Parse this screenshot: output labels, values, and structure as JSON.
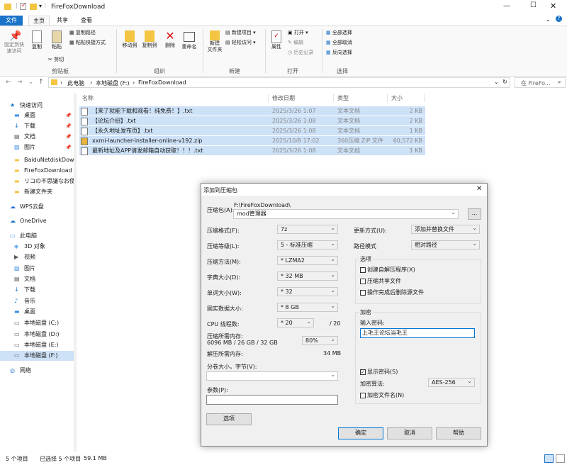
{
  "window": {
    "title": "FireFoxDownload"
  },
  "tabs": {
    "file": "文件",
    "home": "主页",
    "share": "共享",
    "view": "查看"
  },
  "ribbon": {
    "pin": "固定到快\n速访问",
    "copy": "复制",
    "paste": "粘贴",
    "copy_path": "复制路径",
    "paste_shortcut": "粘贴快捷方式",
    "cut": "剪切",
    "clipboard_group": "剪贴板",
    "move_to": "移动到",
    "copy_to": "复制到",
    "delete": "删除",
    "rename": "重命名",
    "organize_group": "组织",
    "new_folder": "新建\n文件夹",
    "new_item": "新建项目",
    "easy_access": "轻松访问",
    "new_group": "新建",
    "properties": "属性",
    "open": "打开",
    "edit": "编辑",
    "history": "历史记录",
    "open_group": "打开",
    "select_all": "全部选择",
    "select_none": "全部取消",
    "invert": "反向选择",
    "select_group": "选择"
  },
  "address": {
    "crumbs": [
      "此电脑",
      "本地磁盘 (F:)",
      "FireFoxDownload"
    ],
    "search_placeholder": "在 FireFo..."
  },
  "nav": {
    "items": [
      {
        "label": "快速访问",
        "indent": 0
      },
      {
        "label": "桌面",
        "indent": 1
      },
      {
        "label": "下载",
        "indent": 1
      },
      {
        "label": "文档",
        "indent": 1
      },
      {
        "label": "图片",
        "indent": 1
      },
      {
        "label": "BaiduNetdiskDow",
        "indent": 1
      },
      {
        "label": "FireFoxDownload",
        "indent": 1
      },
      {
        "label": "リコの不思議なお使",
        "indent": 1
      },
      {
        "label": "新建文件夹",
        "indent": 1
      },
      {
        "label": "WPS云盘",
        "indent": 0
      },
      {
        "label": "OneDrive",
        "indent": 0
      },
      {
        "label": "此电脑",
        "indent": 0
      },
      {
        "label": "3D 对象",
        "indent": 1
      },
      {
        "label": "视频",
        "indent": 1
      },
      {
        "label": "图片",
        "indent": 1
      },
      {
        "label": "文档",
        "indent": 1
      },
      {
        "label": "下载",
        "indent": 1
      },
      {
        "label": "音乐",
        "indent": 1
      },
      {
        "label": "桌面",
        "indent": 1
      },
      {
        "label": "本地磁盘 (C:)",
        "indent": 1
      },
      {
        "label": "本地磁盘 (D:)",
        "indent": 1
      },
      {
        "label": "本地磁盘 (E:)",
        "indent": 1
      },
      {
        "label": "本地磁盘 (F:)",
        "indent": 1
      },
      {
        "label": "网络",
        "indent": 0
      }
    ]
  },
  "columns": {
    "name": "名称",
    "modified": "修改日期",
    "type": "类型",
    "size": "大小"
  },
  "files": [
    {
      "name": "【来了就能下载和观看！纯免费！】.txt",
      "date": "2025/3/26 1:07",
      "type": "文本文档",
      "size": "2 KB"
    },
    {
      "name": "【论坛介绍】.txt",
      "date": "2025/3/26 1:08",
      "type": "文本文档",
      "size": "2 KB"
    },
    {
      "name": "【永久地址发布页】.txt",
      "date": "2025/3/26 1:08",
      "type": "文本文档",
      "size": "1 KB"
    },
    {
      "name": "xxmi-launcher-installer-online-v192.zip",
      "date": "2025/10/8 17:02",
      "type": "360压缩 ZIP 文件",
      "size": "60,572 KB"
    },
    {
      "name": "最新地址及APP请发邮箱自动获取！！！.txt",
      "date": "2025/3/26 1:08",
      "type": "文本文档",
      "size": "1 KB"
    }
  ],
  "status": {
    "count": "5 个项目",
    "selected": "已选择 5 个项目",
    "size": "59.1 MB"
  },
  "dialog": {
    "title": "添加到压缩包",
    "archive_label": "压缩包(A):",
    "archive_path": "F:\\FireFoxDownload\\",
    "archive_name": "mod管理器",
    "browse": "...",
    "format_label": "压缩格式(F):",
    "format": "7z",
    "level_label": "压缩等级(L):",
    "level": "5 - 标准压缩",
    "method_label": "压缩方法(M):",
    "method": "* LZMA2",
    "dict_label": "字典大小(D):",
    "dict": "* 32 MB",
    "word_label": "单词大小(W):",
    "word": "* 32",
    "solid_label": "固实数据大小:",
    "solid": "* 8 GB",
    "cpu_label": "CPU 线程数:",
    "cpu": "* 20",
    "cpu_max": "/ 20",
    "mem_comp_label": "压缩所需内存:",
    "mem_comp_detail": "6096 MB / 26 GB / 32 GB",
    "mem_pct": "80%",
    "mem_decomp_label": "解压所需内存:",
    "mem_decomp": "34 MB",
    "split_label": "分卷大小，字节(V):",
    "params_label": "参数(P):",
    "options_btn": "选项",
    "update_label": "更新方式(U):",
    "update": "添加并替换文件",
    "path_label": "路径模式",
    "path_mode": "相对路径",
    "options_title": "选项",
    "opt_sfx": "创建自解压程序(X)",
    "opt_shared": "压缩共享文件",
    "opt_delete": "操作完成后删除源文件",
    "enc_title": "加密",
    "pwd_label": "输入密码:",
    "pwd": "上毛王论坛当毛王",
    "show_pwd": "显示密码(S)",
    "enc_method_label": "加密算法:",
    "enc_method": "AES-256",
    "enc_names": "加密文件名(N)",
    "ok": "确定",
    "cancel": "取消",
    "help": "帮助"
  }
}
